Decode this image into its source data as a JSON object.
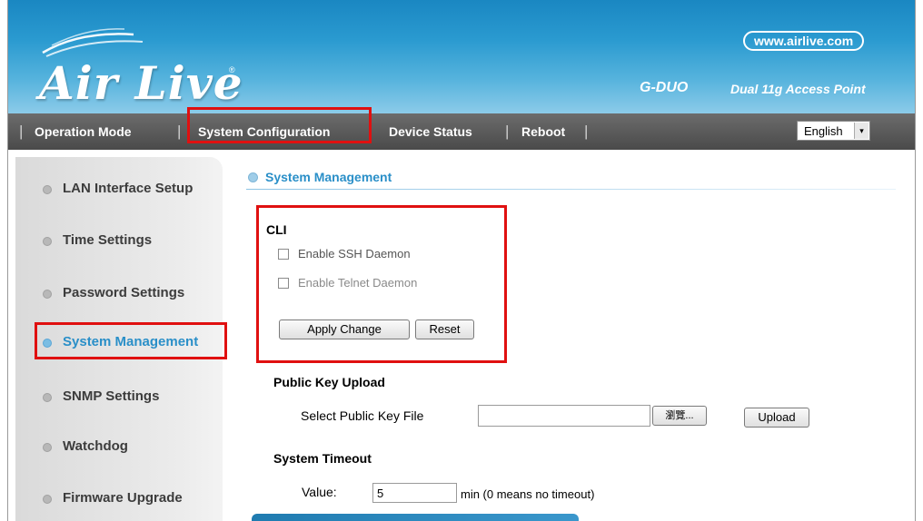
{
  "header": {
    "logo_text": "Air Live",
    "logo_mark": "®",
    "url": "www.airlive.com",
    "model": "G-DUO",
    "model_description": "Dual 11g Access Point",
    "brand_color": "#2a9ad0"
  },
  "nav": {
    "items": [
      {
        "label": "Operation Mode",
        "highlighted": false
      },
      {
        "label": "System Configuration",
        "highlighted": true
      },
      {
        "label": "Device Status",
        "highlighted": false
      },
      {
        "label": "Reboot",
        "highlighted": false
      }
    ],
    "separator": "|",
    "language": {
      "selected": "English",
      "arrow": "▾"
    }
  },
  "sidebar": {
    "items": [
      {
        "label": "LAN Interface Setup",
        "active": false
      },
      {
        "label": "Time Settings",
        "active": false
      },
      {
        "label": "Password Settings",
        "active": false
      },
      {
        "label": "System Management",
        "active": true
      },
      {
        "label": "SNMP Settings",
        "active": false
      },
      {
        "label": "Watchdog",
        "active": false
      },
      {
        "label": "Firmware Upgrade",
        "active": false
      }
    ]
  },
  "main": {
    "title": "System Management",
    "cli": {
      "heading": "CLI",
      "ssh_label": "Enable SSH Daemon",
      "ssh_checked": false,
      "telnet_label": "Enable Telnet Daemon",
      "telnet_checked": false,
      "apply_label": "Apply Change",
      "reset_label": "Reset"
    },
    "public_key": {
      "heading": "Public Key Upload",
      "select_label": "Select Public Key File",
      "file_value": "",
      "browse_label": "瀏覽...",
      "upload_label": "Upload"
    },
    "timeout": {
      "heading": "System Timeout",
      "value_label": "Value:",
      "value": "5",
      "hint": "min (0 means no timeout)"
    }
  },
  "colors": {
    "highlight_red": "#e01010",
    "accent_blue": "#2a8fc8",
    "nav_bg": "#5a5a5a"
  }
}
